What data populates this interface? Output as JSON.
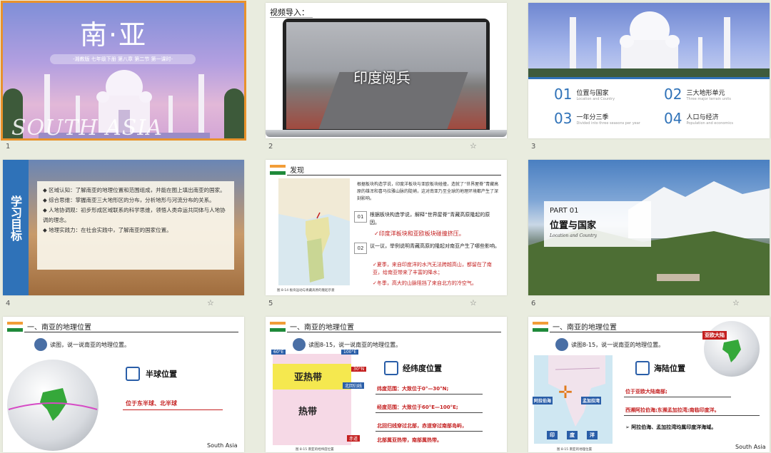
{
  "slides": [
    {
      "number": "1",
      "title": "南·亚",
      "subtitle": "-湘教版 七年级下册 第八章 第二节 第一课时-",
      "en": "SOUTH ASIA"
    },
    {
      "number": "2",
      "label": "视频导入：",
      "video_caption": "印度阅兵"
    },
    {
      "number": "3",
      "items": [
        {
          "num": "01",
          "zh": "位置与国家",
          "en": "Location and Country"
        },
        {
          "num": "02",
          "zh": "三大地形单元",
          "en": "Three major terrain units"
        },
        {
          "num": "03",
          "zh": "一年分三季",
          "en": "Divided into three seasons per year"
        },
        {
          "num": "04",
          "zh": "人口与经济",
          "en": "Population and economics"
        }
      ]
    },
    {
      "number": "4",
      "side_title": "学习目标",
      "bullets": [
        "◆ 区域认知：了解南亚的地理位置和范围组成，并能在图上填出南亚的国家。",
        "◆ 综合思维：掌握南亚三大地形区的分布，分析地形与河流分布的关系。",
        "◆ 人地协调观：初步形成区域联系的科学思维，领悟人类命运共同体与人地协调的理念。",
        "◆ 地理实践力：在社会实践中，了解南亚的国家位置。"
      ]
    },
    {
      "number": "5",
      "header": "发现",
      "intro": "根据板块构造学说，印度洋板块与亚欧板块碰撞，造就了“世界屋脊”青藏高原的雄浑和喜马拉雅山脉的陡峭，这对南亚乃至全球的地理环境都产生了深刻影响。",
      "q1_num": "01",
      "q1": "根据板块构造学说，解释“世界屋脊”青藏高原隆起的原因。",
      "a1": "✓印度洋板块和亚欧板块碰撞挤压。",
      "q2_num": "02",
      "q2": "议一议，举例说明青藏高原的隆起对南亚产生了哪些影响。",
      "a2a": "✓夏季，来自印度洋的水汽无法跨越高山，都留在了南亚，给南亚带来了丰富的降水；",
      "a2b": "✓冬季，高大的山脉阻挡了来自北方的冷空气。",
      "map_caption": "图 8-14 板块运动与青藏高原的隆起示意"
    },
    {
      "number": "6",
      "part": "PART 01",
      "title": "位置与国家",
      "en": "Location and Country"
    },
    {
      "number": "7",
      "header": "一、南亚的地理位置",
      "prompt": "读图，说一说南亚的地理位置。",
      "box_title": "半球位置",
      "answer": "位于东半球、北半球",
      "footer": "South Asia"
    },
    {
      "number": "8",
      "header": "一、南亚的地理位置",
      "prompt": "读图8-15，说一说南亚的地理位置。",
      "box_title": "经纬度位置",
      "lines": [
        "纬度范围：大致位于0°—30°N;",
        "经度范围：大致位于60°E—100°E;",
        "北回归线穿过北部，赤道穿过南部岛屿，",
        "北部属亚热带，南部属热带。"
      ],
      "map_labels": {
        "lon_left": "60°E",
        "lon_right": "100°E",
        "lat_top": "30°N",
        "tropic": "北回归线",
        "equator": "赤道",
        "zone1": "亚热带",
        "zone2": "热带"
      },
      "caption": "图 8-15  南亚的经纬度位置"
    },
    {
      "number": "9",
      "header": "一、南亚的地理位置",
      "prompt": "读图8-15，说一说南亚的地理位置。",
      "box_title": "海陆位置",
      "globe_label": "亚欧大陆",
      "lines": [
        "位于亚欧大陆南部;",
        "西濒阿拉伯海;东濒孟加拉湾;南临印度洋。"
      ],
      "bullet": "➢ 阿拉伯海、孟加拉湾均属印度洋海域。",
      "map_labels": {
        "west": "阿拉伯海",
        "east": "孟加拉湾",
        "south_chars": [
          "印",
          "度",
          "洋"
        ]
      },
      "caption": "图 8-15  南亚的地理位置",
      "footer": "South Asia"
    }
  ],
  "colors": {
    "accent": "#e8922c",
    "blue": "#2a5ea8",
    "red": "#c42020",
    "panel_blue": "#2f72b8"
  },
  "icons": {
    "star": "star-icon",
    "flag": "india-flag-icon"
  }
}
